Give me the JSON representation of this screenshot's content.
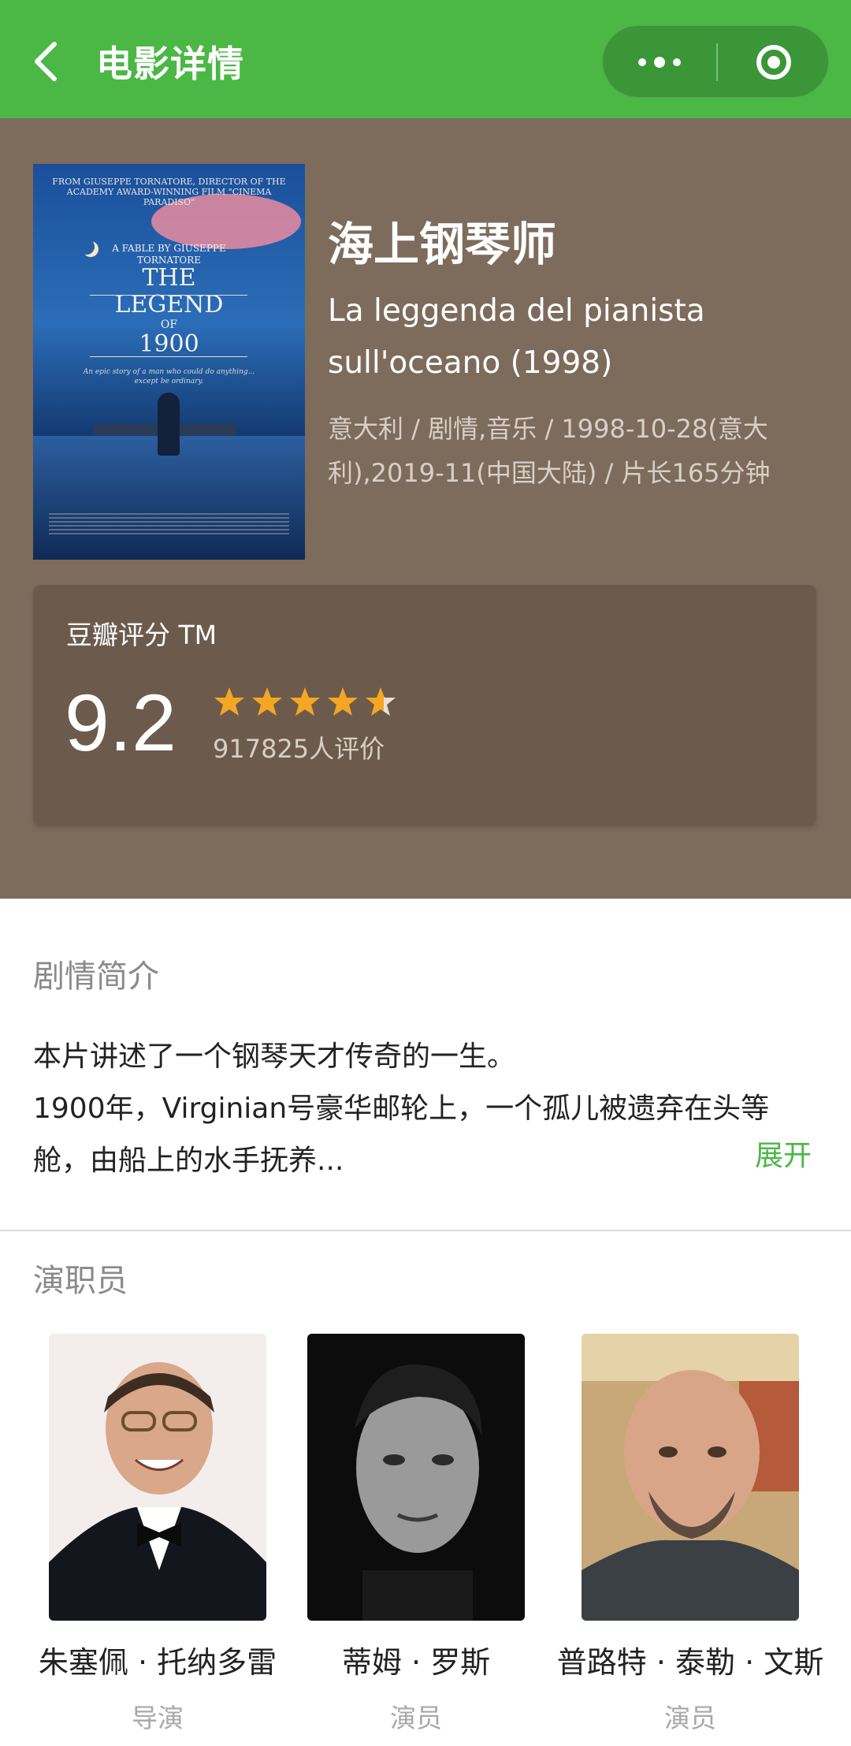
{
  "navbar": {
    "title": "电影详情",
    "accent": "#4bb745"
  },
  "movie": {
    "title": "海上钢琴师",
    "original_title": "La leggenda del pianista sull'oceano (1998)",
    "meta": "意大利 / 剧情,音乐 / 1998-10-28(意大利),2019-11(中国大陆) / 片长165分钟",
    "poster": {
      "top_line": "FROM GIUSEPPE TORNATORE, DIRECTOR OF THE ACADEMY AWARD-WINNING FILM \"CINEMA PARADISO\"",
      "fable": "A FABLE BY GIUSEPPE TORNATORE",
      "title_line1": "THE",
      "title_line2": "LEGEND",
      "title_of": "OF",
      "title_line3": "1900",
      "tagline": "An epic story of a man who could do anything... except be ordinary."
    }
  },
  "rating": {
    "label": "豆瓣评分 TM",
    "score": "9.2",
    "stars": 4.6,
    "count": "917825人评价",
    "star_color": "#f5a623"
  },
  "synopsis": {
    "heading": "剧情简介",
    "text": "本片讲述了一个钢琴天才传奇的一生。\n1900年，Virginian号豪华邮轮上，一个孤儿被遗弃在头等舱，由船上的水手抚养...",
    "expand": "展开"
  },
  "cast": {
    "heading": "演职员",
    "members": [
      {
        "name": "朱塞佩 · 托纳多雷",
        "role": "导演"
      },
      {
        "name": "蒂姆 · 罗斯",
        "role": "演员"
      },
      {
        "name": "普路特 · 泰勒 · 文斯",
        "role": "演员"
      }
    ]
  }
}
